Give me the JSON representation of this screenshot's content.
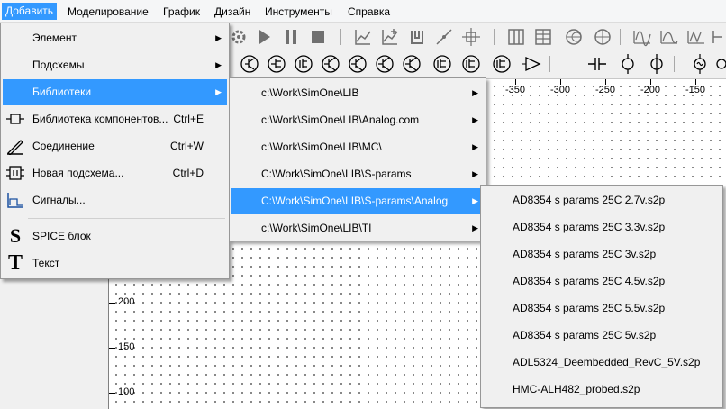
{
  "menubar": {
    "items": [
      "Добавить",
      "Моделирование",
      "График",
      "Дизайн",
      "Инструменты",
      "Справка"
    ]
  },
  "main_menu": {
    "items": [
      {
        "label": "Элемент",
        "accel": "",
        "submenu": true,
        "icon": ""
      },
      {
        "label": "Подсхемы",
        "accel": "",
        "submenu": true,
        "icon": ""
      },
      {
        "label": "Библиотеки",
        "accel": "",
        "submenu": true,
        "icon": ""
      },
      {
        "label": "Библиотека компонентов...",
        "accel": "Ctrl+E",
        "submenu": false,
        "icon": "component-library-icon"
      },
      {
        "label": "Соединение",
        "accel": "Ctrl+W",
        "submenu": false,
        "icon": "pen-wire-icon"
      },
      {
        "label": "Новая подсхема...",
        "accel": "Ctrl+D",
        "submenu": false,
        "icon": "subcircuit-icon"
      },
      {
        "label": "Сигналы...",
        "accel": "",
        "submenu": false,
        "icon": "signals-icon"
      },
      {
        "label": "SPICE блок",
        "accel": "",
        "submenu": false,
        "icon": "S"
      },
      {
        "label": "Текст",
        "accel": "",
        "submenu": false,
        "icon": "T"
      }
    ],
    "highlighted": "Библиотеки"
  },
  "libs_menu": {
    "items": [
      "c:\\Work\\SimOne\\LIB",
      "c:\\Work\\SimOne\\LIB\\Analog.com",
      "c:\\Work\\SimOne\\LIB\\MC\\",
      "C:\\Work\\SimOne\\LIB\\S-params",
      "C:\\Work\\SimOne\\LIB\\S-params\\Analog",
      "c:\\Work\\SimOne\\LIB\\TI"
    ],
    "highlighted": "C:\\Work\\SimOne\\LIB\\S-params\\Analog"
  },
  "files_menu": {
    "items": [
      "AD8354 s params 25C  2.7v.s2p",
      "AD8354 s params 25C  3.3v.s2p",
      "AD8354 s params 25C  3v.s2p",
      "AD8354 s params 25C  4.5v.s2p",
      "AD8354 s params 25C  5.5v.s2p",
      "AD8354 s params 25C  5v.s2p",
      "ADL5324_Deembedded_RevC_5V.s2p",
      "HMC-ALH482_probed.s2p"
    ]
  },
  "ruler": {
    "top": [
      "-350",
      "-300",
      "-250",
      "-200",
      "-150"
    ],
    "left": [
      "200",
      "150",
      "100"
    ]
  },
  "colors": {
    "highlight": "#3399ff",
    "menu_bg": "#f0f0f0",
    "canvas_bg": "#ffffff"
  }
}
